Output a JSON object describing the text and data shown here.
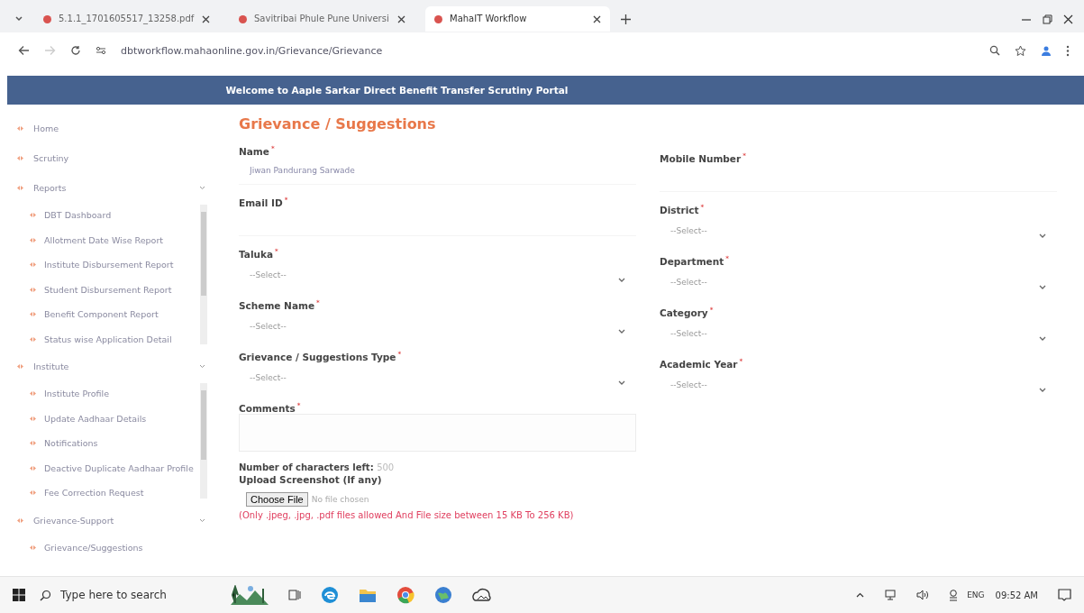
{
  "browser": {
    "tabs": [
      {
        "title": "5.1.1_1701605517_13258.pdf",
        "selected": false
      },
      {
        "title": "Savitribai Phule Pune Universi",
        "selected": false
      },
      {
        "title": "MahaIT Workflow",
        "selected": true
      }
    ],
    "url": "dbtworkflow.mahaonline.gov.in/Grievance/Grievance"
  },
  "banner": {
    "title": "Welcome to Aaple Sarkar Direct Benefit Transfer Scrutiny Portal"
  },
  "sidebar": {
    "items": [
      {
        "label": "Home"
      },
      {
        "label": "Scrutiny"
      },
      {
        "label": "Reports",
        "expanded": true,
        "children": [
          {
            "label": "DBT Dashboard"
          },
          {
            "label": "Allotment Date Wise Report"
          },
          {
            "label": "Institute Disbursement Report"
          },
          {
            "label": "Student Disbursement Report"
          },
          {
            "label": "Benefit Component Report"
          },
          {
            "label": "Status wise Application Detail"
          }
        ]
      },
      {
        "label": "Institute",
        "expanded": true,
        "children": [
          {
            "label": "Institute Profile"
          },
          {
            "label": "Update Aadhaar Details"
          },
          {
            "label": "Notifications"
          },
          {
            "label": "Deactive Duplicate Aadhaar Profile"
          },
          {
            "label": "Fee Correction Request"
          }
        ]
      },
      {
        "label": "Grievance-Support",
        "expanded": true,
        "children": [
          {
            "label": "Grievance/Suggestions"
          }
        ]
      }
    ]
  },
  "form": {
    "title": "Grievance / Suggestions",
    "left": [
      {
        "kind": "text",
        "label": "Name",
        "asterisk": "*",
        "value": "Jiwan Pandurang Sarwade"
      },
      {
        "kind": "text",
        "label": "Email ID",
        "asterisk": "*"
      },
      {
        "kind": "select",
        "label": "Taluka",
        "asterisk": "*",
        "placeholder": "--Select--"
      },
      {
        "kind": "select",
        "label": "Scheme Name",
        "asterisk": "*",
        "placeholder": "--Select--"
      },
      {
        "kind": "select",
        "label": "Grievance / Suggestions Type",
        "asterisk": "*",
        "placeholder": "--Select--"
      },
      {
        "kind": "textarea",
        "label": "Comments",
        "asterisk": "*"
      }
    ],
    "right": [
      {
        "kind": "text",
        "label": "Mobile Number",
        "asterisk": "*"
      },
      {
        "kind": "select",
        "label": "District",
        "asterisk": "*",
        "placeholder": "--Select--"
      },
      {
        "kind": "select",
        "label": "Department",
        "asterisk": "*",
        "placeholder": "--Select--"
      },
      {
        "kind": "select",
        "label": "Category",
        "asterisk": "*",
        "placeholder": "--Select--"
      },
      {
        "kind": "select",
        "label": "Academic Year",
        "asterisk": "*",
        "placeholder": "--Select--"
      }
    ],
    "chars_left_label": "Number of characters left:",
    "chars_left_value": "500",
    "upload_label": "Upload Screenshot (If any)",
    "choose_button": "Choose File",
    "no_file": "No file chosen",
    "upload_note": "(Only .jpeg, .jpg, .pdf files allowed And File size between 15 KB To 256 KB)"
  },
  "taskbar": {
    "search_placeholder": "Type here to search",
    "language": "ENG",
    "time": "09:52 AM"
  }
}
